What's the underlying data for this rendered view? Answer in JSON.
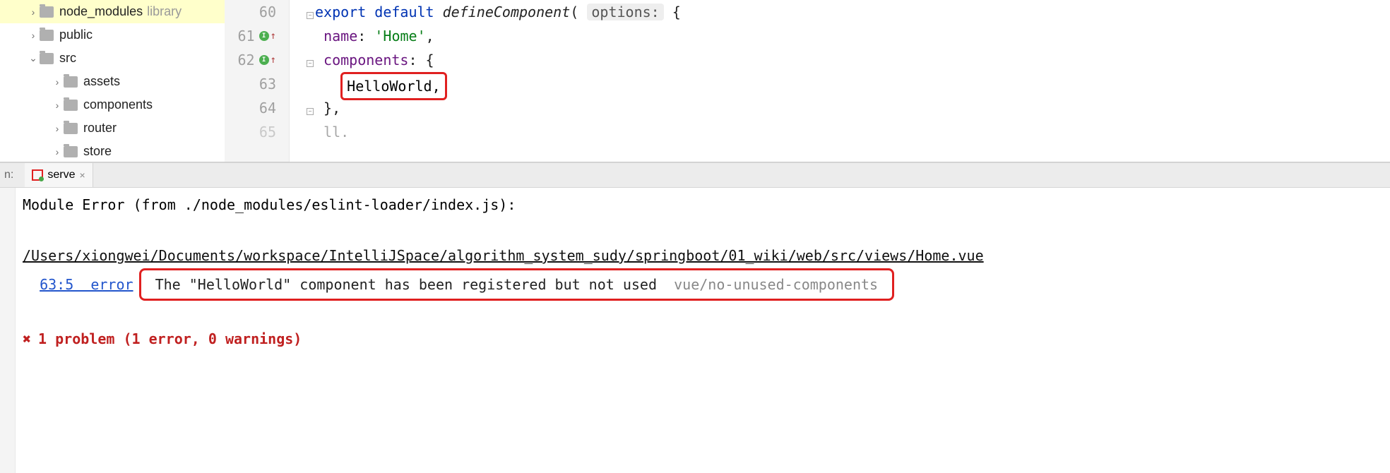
{
  "tree": {
    "items": [
      {
        "label": "node_modules",
        "hint": "library",
        "arrow": "›",
        "indent": 0,
        "hl": true
      },
      {
        "label": "public",
        "hint": "",
        "arrow": "›",
        "indent": 0,
        "hl": false
      },
      {
        "label": "src",
        "hint": "",
        "arrow": "⌄",
        "indent": 0,
        "hl": false
      },
      {
        "label": "assets",
        "hint": "",
        "arrow": "›",
        "indent": 1,
        "hl": false
      },
      {
        "label": "components",
        "hint": "",
        "arrow": "›",
        "indent": 1,
        "hl": false
      },
      {
        "label": "router",
        "hint": "",
        "arrow": "›",
        "indent": 1,
        "hl": false
      },
      {
        "label": "store",
        "hint": "",
        "arrow": "›",
        "indent": 1,
        "hl": false
      }
    ]
  },
  "editor": {
    "lines": [
      {
        "num": "60",
        "badge": false
      },
      {
        "num": "61",
        "badge": true
      },
      {
        "num": "62",
        "badge": true
      },
      {
        "num": "63",
        "badge": false
      },
      {
        "num": "64",
        "badge": false
      },
      {
        "num": "65",
        "badge": false
      }
    ],
    "code": {
      "l60_export": "export",
      "l60_default": "default",
      "l60_fn": "defineComponent",
      "l60_hint": "options:",
      "l60_brace": "{",
      "l61_prop": "name",
      "l61_colon": ": ",
      "l61_str": "'Home'",
      "l61_comma": ",",
      "l62_prop": "components",
      "l62_rest": ": {",
      "l63_val": "HelloWorld,",
      "l64": "},",
      "l65": "ll."
    }
  },
  "tabbar": {
    "run": "n:",
    "tab": "serve"
  },
  "console": {
    "l1": "Module Error (from ./node_modules/eslint-loader/index.js):",
    "l3_path": "/Users/xiongwei/Documents/workspace/IntelliJSpace/algorithm_system_sudy/springboot/01_wiki/web/src/views/Home.vue",
    "l4_link": "63:5  error",
    "l4_msg": "The \"HelloWorld\" component has been registered but not used",
    "l4_rule": "vue/no-unused-components",
    "l6_x": "✖",
    "l6_text": "1 problem (1 error, 0 warnings)"
  }
}
